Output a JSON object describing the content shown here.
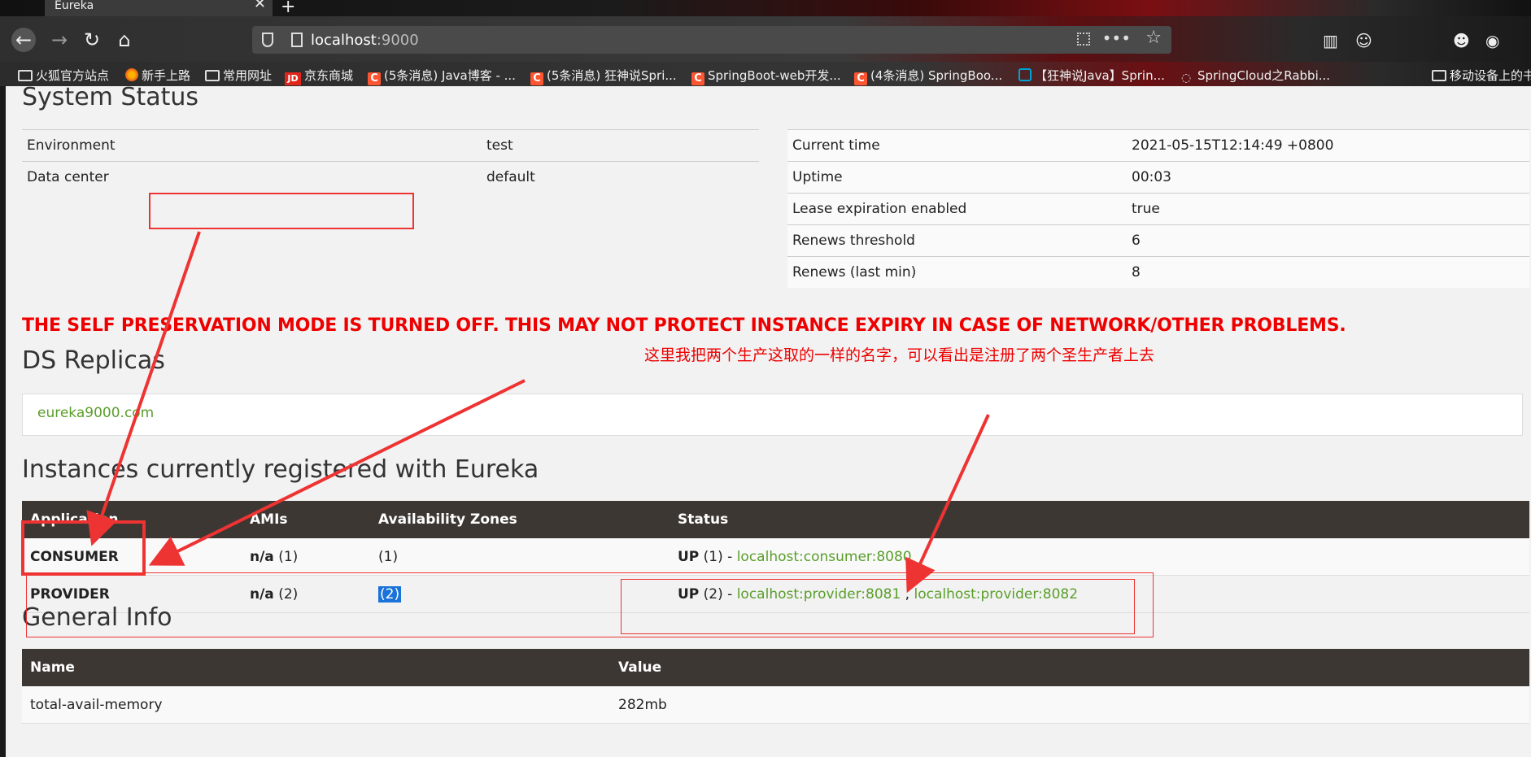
{
  "browser": {
    "tab_title": "Eureka",
    "url_host": "localhost",
    "url_port": ":9000",
    "bookmarks": [
      {
        "label": "火狐官方站点",
        "icon": "folder-icon"
      },
      {
        "label": "新手上路",
        "icon": "firefox-icon"
      },
      {
        "label": "常用网址",
        "icon": "folder-icon"
      },
      {
        "label": "京东商城",
        "icon": "jd-icon"
      },
      {
        "label": "(5条消息) Java博客 - ...",
        "icon": "csdn-icon"
      },
      {
        "label": "(5条消息) 狂神说Spri...",
        "icon": "csdn-icon"
      },
      {
        "label": "SpringBoot-web开发...",
        "icon": "csdn-icon"
      },
      {
        "label": "(4条消息) SpringBoo...",
        "icon": "csdn-icon"
      },
      {
        "label": "【狂神说Java】Sprin...",
        "icon": "bilibili-icon"
      },
      {
        "label": "SpringCloud之Rabbi...",
        "icon": "github-icon"
      },
      {
        "label": "移动设备上的书",
        "icon": "folder-icon"
      }
    ]
  },
  "system_status": {
    "title": "System Status",
    "left": [
      {
        "label": "Environment",
        "value": "test"
      },
      {
        "label": "Data center",
        "value": "default"
      }
    ],
    "right": [
      {
        "label": "Current time",
        "value": "2021-05-15T12:14:49 +0800"
      },
      {
        "label": "Uptime",
        "value": "00:03"
      },
      {
        "label": "Lease expiration enabled",
        "value": "true"
      },
      {
        "label": "Renews threshold",
        "value": "6"
      },
      {
        "label": "Renews (last min)",
        "value": "8"
      }
    ]
  },
  "warning": "THE SELF PRESERVATION MODE IS TURNED OFF. THIS MAY NOT PROTECT INSTANCE EXPIRY IN CASE OF NETWORK/OTHER PROBLEMS.",
  "annotation_note": "这里我把两个生产这取的一样的名字，可以看出是注册了两个圣生产者上去",
  "ds_replicas": {
    "title": "DS Replicas",
    "link": "eureka9000.com"
  },
  "instances": {
    "title": "Instances currently registered with Eureka",
    "headers": [
      "Application",
      "AMIs",
      "Availability Zones",
      "Status"
    ],
    "rows": [
      {
        "app": "CONSUMER",
        "amis_na": "n/a",
        "amis_count": "(1)",
        "zones": "(1)",
        "status": "UP",
        "status_count": "(1) - ",
        "links": [
          "localhost:consumer:8080"
        ]
      },
      {
        "app": "PROVIDER",
        "amis_na": "n/a",
        "amis_count": "(2)",
        "zones": "(2)",
        "status": "UP",
        "status_count": "(2) - ",
        "links": [
          "localhost:provider:8081",
          "localhost:provider:8082"
        ],
        "link_sep": " , "
      }
    ]
  },
  "general_info": {
    "title": "General Info",
    "headers": [
      "Name",
      "Value"
    ],
    "rows": [
      {
        "name": "total-avail-memory",
        "value": "282mb"
      }
    ]
  },
  "colors": {
    "accent_green": "#5a9e2a",
    "warning_red": "#ee0000",
    "header_dark": "#3d3733",
    "annotation_red": "#e33333"
  }
}
